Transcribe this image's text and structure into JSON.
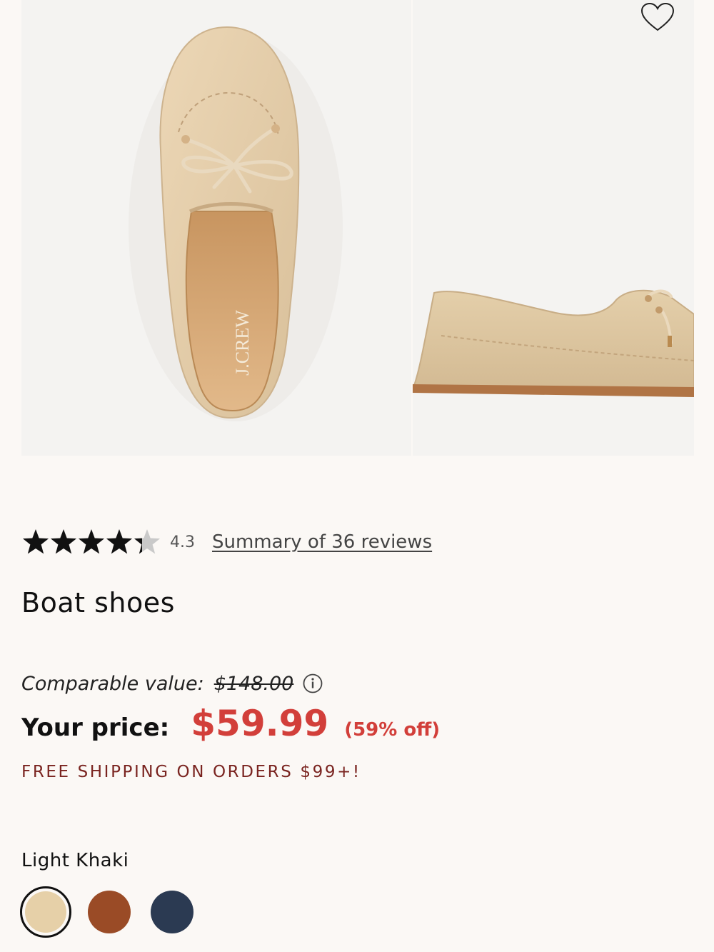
{
  "gallery": {
    "images": [
      {
        "alt": "boat shoe top view",
        "brand_mark": "J.CREW"
      },
      {
        "alt": "boat shoe side view"
      }
    ],
    "wishlist_icon": "heart-outline-icon"
  },
  "rating": {
    "stars": 4.3,
    "value_label": "4.3",
    "reviews_link": "Summary of 36 reviews"
  },
  "product": {
    "title": "Boat shoes"
  },
  "pricing": {
    "comparable_label": "Comparable value:",
    "comparable_value": "$148.00",
    "your_price_label": "Your price:",
    "your_price": "$59.99",
    "discount": "(59% off)",
    "price_color": "#d23f3a"
  },
  "shipping": {
    "promo": "FREE SHIPPING ON ORDERS $99+!",
    "color": "#7a2420"
  },
  "color_selector": {
    "selected_name": "Light Khaki",
    "swatches": [
      {
        "name": "Light Khaki",
        "color": "#e6d0a8",
        "selected": true
      },
      {
        "name": "Brown",
        "color": "#9a4b26",
        "selected": false
      },
      {
        "name": "Navy",
        "color": "#2b3a52",
        "selected": false
      }
    ]
  }
}
